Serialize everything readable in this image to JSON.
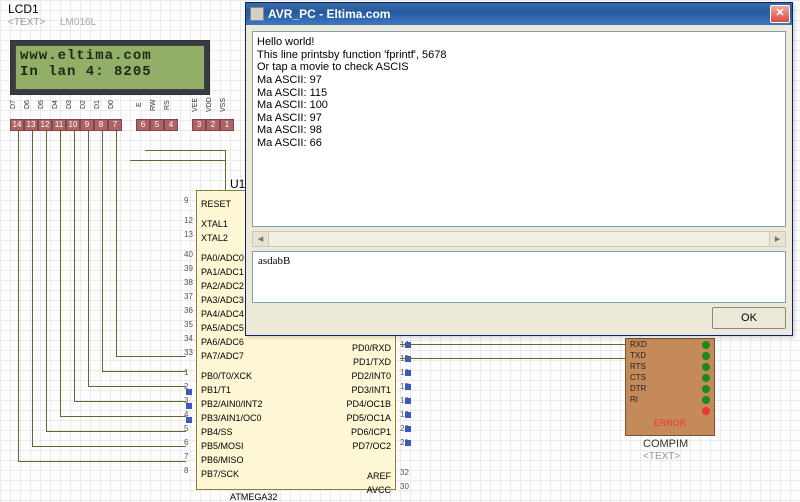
{
  "labels": {
    "lcd_ref": "LCD1",
    "lcd_text_ph": "<TEXT>",
    "lcd_part": "LM016L",
    "lcd_line1": "www.eltima.com",
    "lcd_line2": "In lan 4: 8205",
    "u1": "U1",
    "ic_name": "ATMEGA32",
    "compim": "COMPIM",
    "compim_text_ph": "<TEXT>",
    "error": "ERROR"
  },
  "lcd_pins": {
    "names": [
      "D7",
      "D6",
      "D5",
      "D4",
      "D3",
      "D2",
      "D1",
      "D0",
      "",
      "E",
      "RW",
      "RS",
      "",
      "VEE",
      "VDD",
      "VSS"
    ],
    "nums": [
      "14",
      "13",
      "12",
      "11",
      "10",
      "9",
      "8",
      "7",
      "",
      "6",
      "5",
      "4",
      "",
      "3",
      "2",
      "1"
    ]
  },
  "ic_left_pins": [
    {
      "n": "9",
      "t": "RESET"
    },
    {
      "n": "12",
      "t": "XTAL1"
    },
    {
      "n": "13",
      "t": "XTAL2"
    },
    {
      "n": "40",
      "t": "PA0/ADC0"
    },
    {
      "n": "39",
      "t": "PA1/ADC1"
    },
    {
      "n": "38",
      "t": "PA2/ADC2"
    },
    {
      "n": "37",
      "t": "PA3/ADC3"
    },
    {
      "n": "36",
      "t": "PA4/ADC4"
    },
    {
      "n": "35",
      "t": "PA5/ADC5"
    },
    {
      "n": "34",
      "t": "PA6/ADC6"
    },
    {
      "n": "33",
      "t": "PA7/ADC7"
    },
    {
      "n": "1",
      "t": "PB0/T0/XCK"
    },
    {
      "n": "2",
      "t": "PB1/T1"
    },
    {
      "n": "3",
      "t": "PB2/AIN0/INT2"
    },
    {
      "n": "4",
      "t": "PB3/AIN1/OC0"
    },
    {
      "n": "5",
      "t": "PB4/SS"
    },
    {
      "n": "6",
      "t": "PB5/MOSI"
    },
    {
      "n": "7",
      "t": "PB6/MISO"
    },
    {
      "n": "8",
      "t": "PB7/SCK"
    }
  ],
  "ic_right_pins": [
    {
      "n": "14",
      "t": "PD0/RXD"
    },
    {
      "n": "15",
      "t": "PD1/TXD"
    },
    {
      "n": "16",
      "t": "PD2/INT0"
    },
    {
      "n": "17",
      "t": "PD3/INT1"
    },
    {
      "n": "18",
      "t": "PD4/OC1B"
    },
    {
      "n": "19",
      "t": "PD5/OC1A"
    },
    {
      "n": "20",
      "t": "PD6/ICP1"
    },
    {
      "n": "21",
      "t": "PD7/OC2"
    },
    {
      "n": "32",
      "t": "AREF"
    },
    {
      "n": "30",
      "t": "AVCC"
    }
  ],
  "compim_rows": [
    "RXD",
    "TXD",
    "RTS",
    "CTS",
    "DTR",
    "RI"
  ],
  "dialog": {
    "title": "AVR_PC  -  Eltima.com",
    "terminal": [
      "Hello world!",
      "This line printsby function 'fprintf', 5678",
      "Or tap a movie to check ASCIS",
      "Ma ASCII: 97",
      "Ma ASCII: 115",
      "Ma ASCII: 100",
      "Ma ASCII: 97",
      "Ma ASCII: 98",
      "Ma ASCII: 66"
    ],
    "input_value": "asdabB",
    "ok": "OK"
  }
}
